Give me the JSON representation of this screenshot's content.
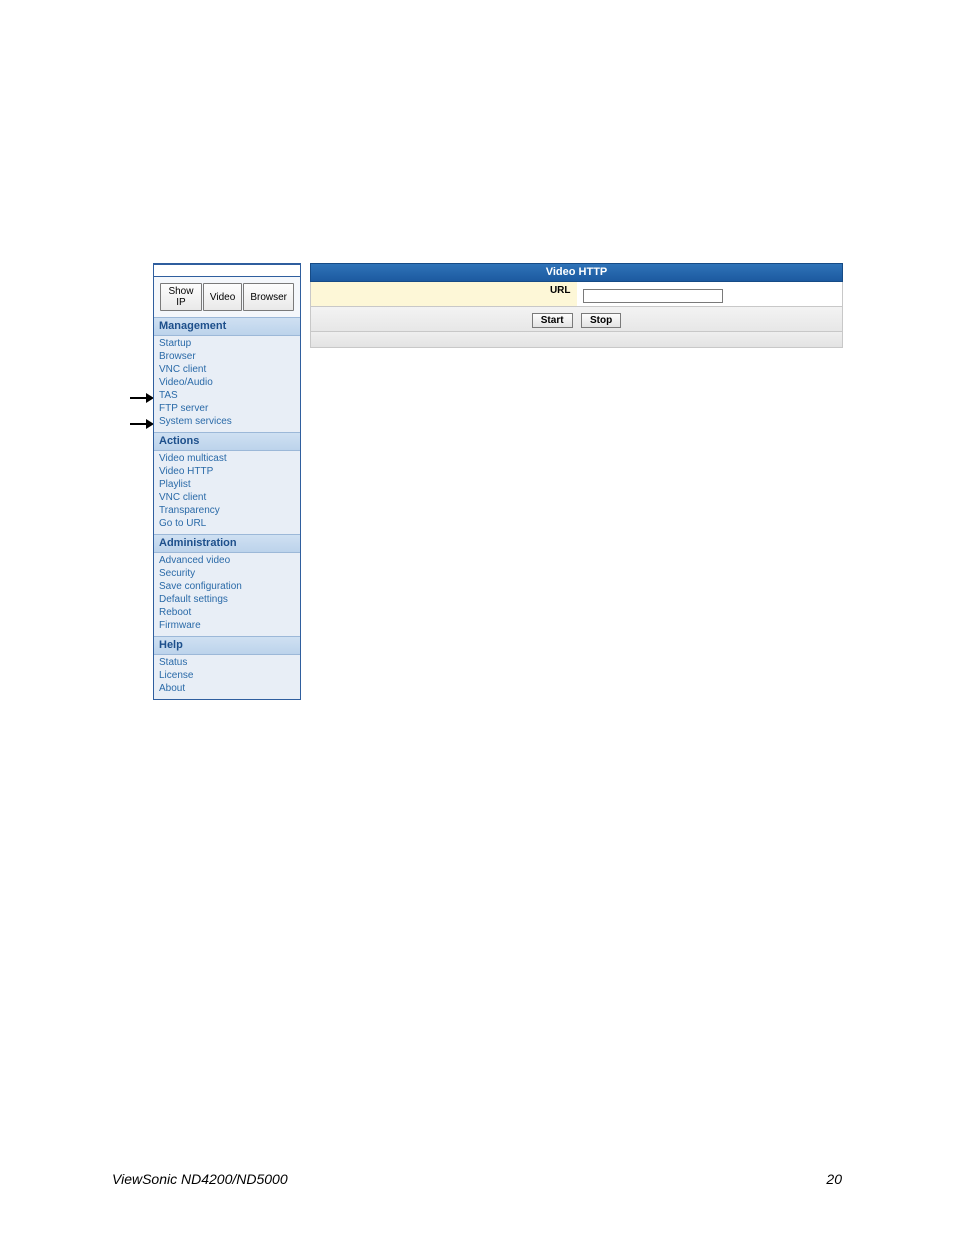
{
  "sidebar": {
    "buttons": {
      "show_ip": "Show IP",
      "video": "Video",
      "browser": "Browser"
    },
    "sections": {
      "management": {
        "title": "Management",
        "items": [
          "Startup",
          "Browser",
          "VNC client",
          "Video/Audio",
          "TAS",
          "FTP server",
          "System services"
        ]
      },
      "actions": {
        "title": "Actions",
        "items": [
          "Video multicast",
          "Video HTTP",
          "Playlist",
          "VNC client",
          "Transparency",
          "Go to URL"
        ]
      },
      "administration": {
        "title": "Administration",
        "items": [
          "Advanced video",
          "Security",
          "Save configuration",
          "Default settings",
          "Reboot",
          "Firmware"
        ]
      },
      "help": {
        "title": "Help",
        "items": [
          "Status",
          "License",
          "About"
        ]
      }
    }
  },
  "main": {
    "panel_title": "Video HTTP",
    "url_label": "URL",
    "url_value": "",
    "start_label": "Start",
    "stop_label": "Stop"
  },
  "footer": {
    "left": "ViewSonic ND4200/ND5000",
    "right": "20"
  }
}
